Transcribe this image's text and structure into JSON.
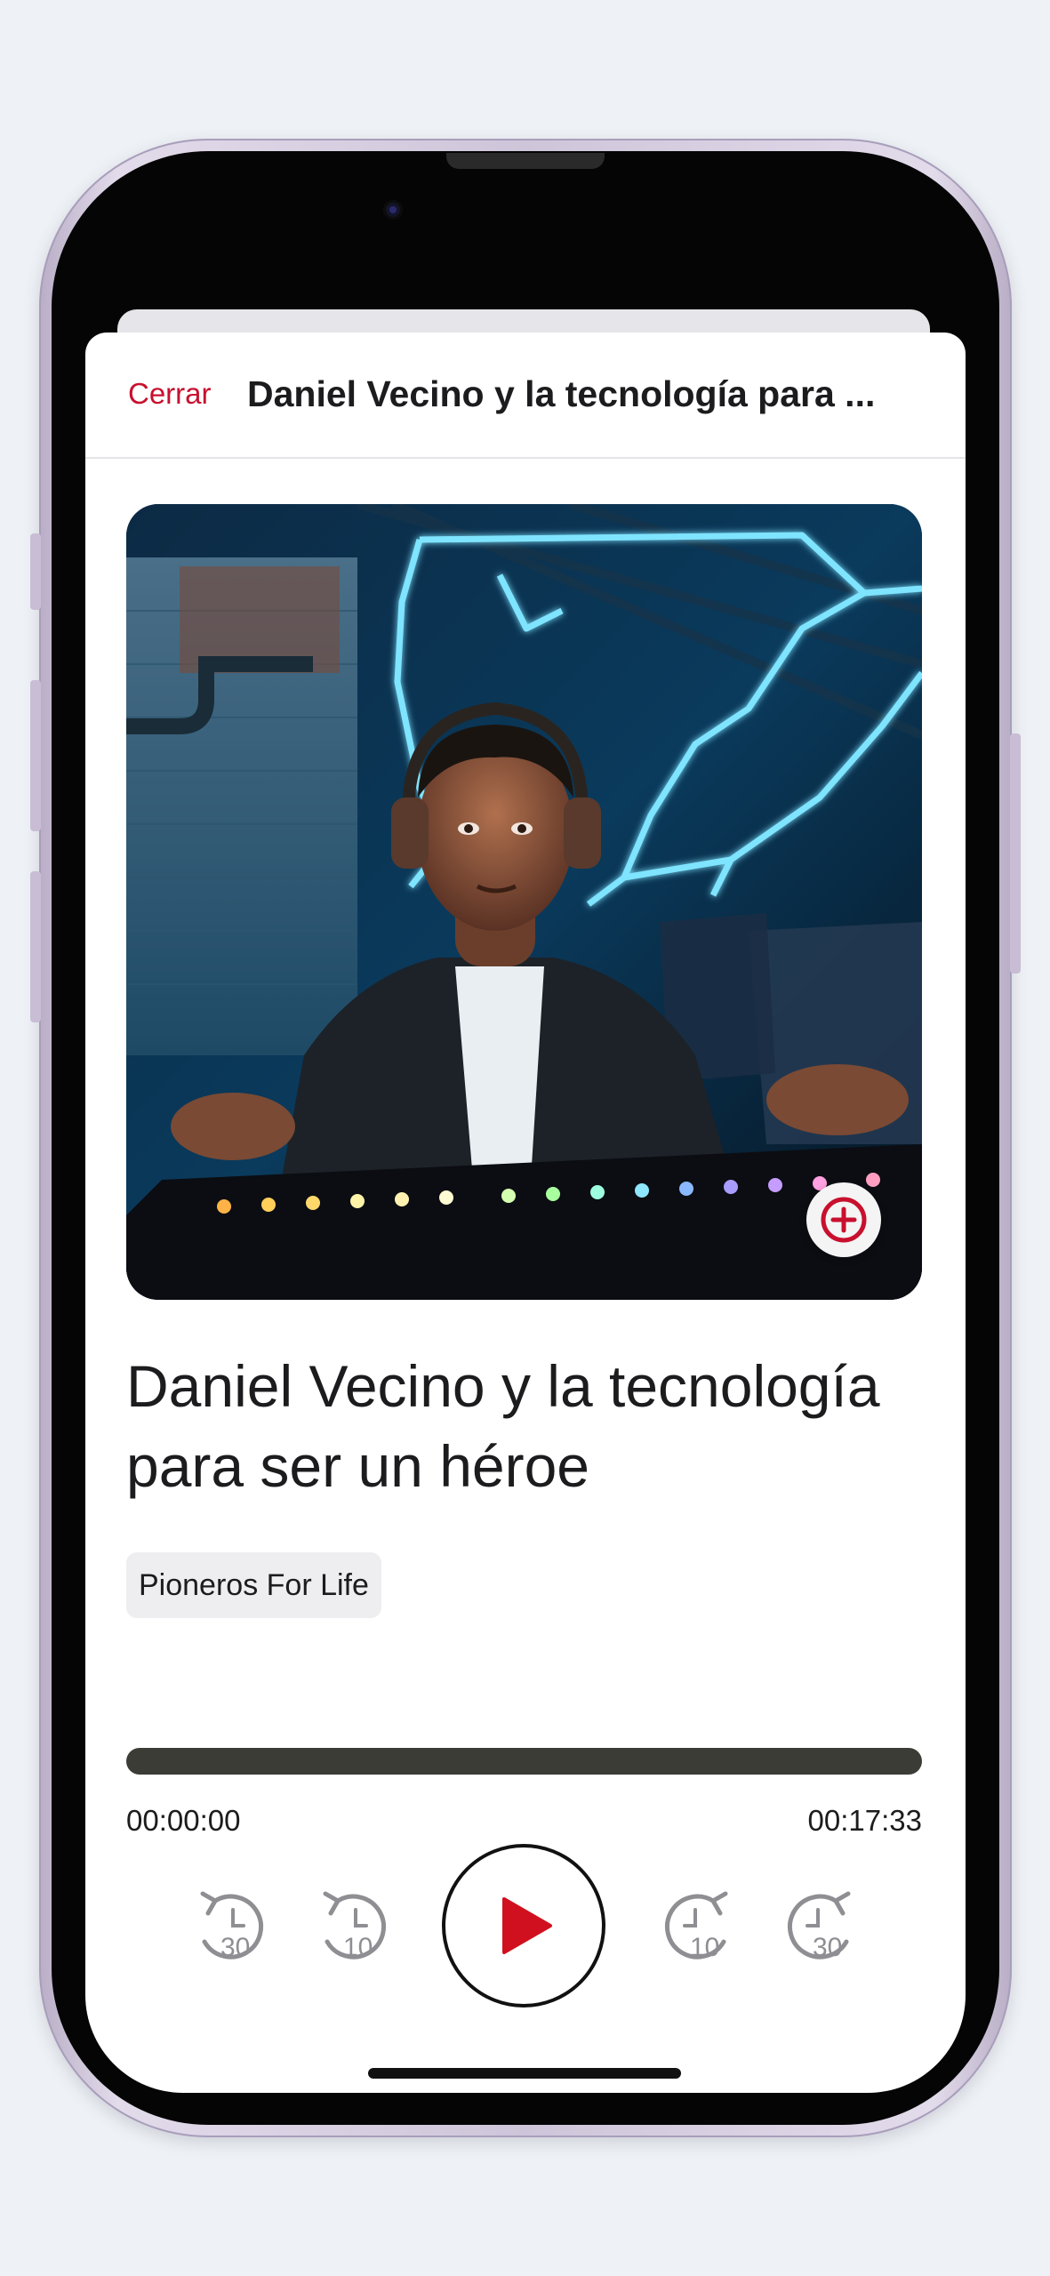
{
  "nav": {
    "close_label": "Cerrar",
    "title": "Daniel Vecino y la tecnología para ..."
  },
  "episode": {
    "title": "Daniel Vecino y la tecnología para ser un héroe",
    "show_name": "Pioneros For Life",
    "artwork_icon": "podcast-artwork-gamer-image",
    "add_icon": "plus-circle-icon"
  },
  "player": {
    "elapsed": "00:00:00",
    "duration": "00:17:33",
    "progress_fraction": 0,
    "skip_back_30_label": "30",
    "skip_back_10_label": "10",
    "skip_forward_10_label": "10",
    "skip_forward_30_label": "30",
    "play_icon": "play-icon"
  },
  "colors": {
    "accent": "#c8102e",
    "track": "#3c3c37",
    "text": "#1c1c1e",
    "icon_gray": "#8e8e93"
  }
}
